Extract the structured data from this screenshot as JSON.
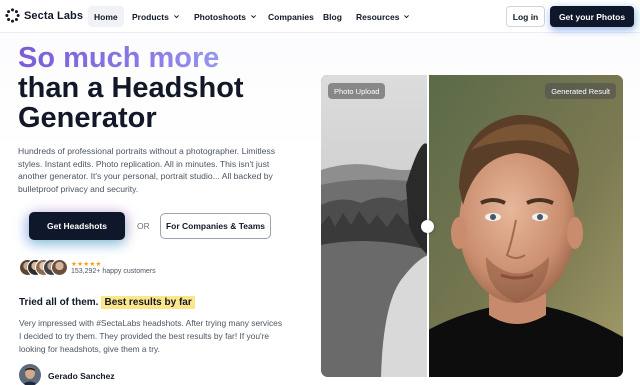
{
  "nav": {
    "brand": "Secta Labs",
    "items": [
      {
        "label": "Home",
        "active": true,
        "dropdown": false
      },
      {
        "label": "Products",
        "active": false,
        "dropdown": true
      },
      {
        "label": "Photoshoots",
        "active": false,
        "dropdown": true
      },
      {
        "label": "Companies",
        "active": false,
        "dropdown": false
      },
      {
        "label": "Blog",
        "active": false,
        "dropdown": false
      },
      {
        "label": "Resources",
        "active": false,
        "dropdown": true
      }
    ],
    "login": "Log in",
    "cta": "Get your Photos"
  },
  "hero": {
    "title_line1": "So much more",
    "title_line2": "than a Headshot",
    "title_line3": "Generator",
    "description": "Hundreds of professional portraits without a photographer. Limitless styles. Instant edits. Photo replication. All in minutes. This isn't just another generator. It's your personal, portrait studio... All backed by bulletproof privacy and security.",
    "primary_cta": "Get Headshots",
    "or": "OR",
    "secondary_cta": "For Companies & Teams"
  },
  "social_proof": {
    "stars": "★★★★★",
    "rating": 5,
    "customers": "153,292+ happy customers"
  },
  "testimonial": {
    "lead": "Tried all of them.",
    "highlight": "Best results by far",
    "quote": "Very impressed with #SectaLabs headshots. After trying many services I decided to try them. They provided the best results by far! If you're looking for headshots, give them a try.",
    "author": "Gerado Sanchez"
  },
  "comparison": {
    "left_label": "Photo Upload",
    "right_label": "Generated Result"
  },
  "colors": {
    "brand_dark": "#0f172a",
    "gradient_start": "#7c5cd6",
    "gradient_end": "#a5c4ef",
    "star": "#f59e0b",
    "highlight": "#fde68a"
  }
}
